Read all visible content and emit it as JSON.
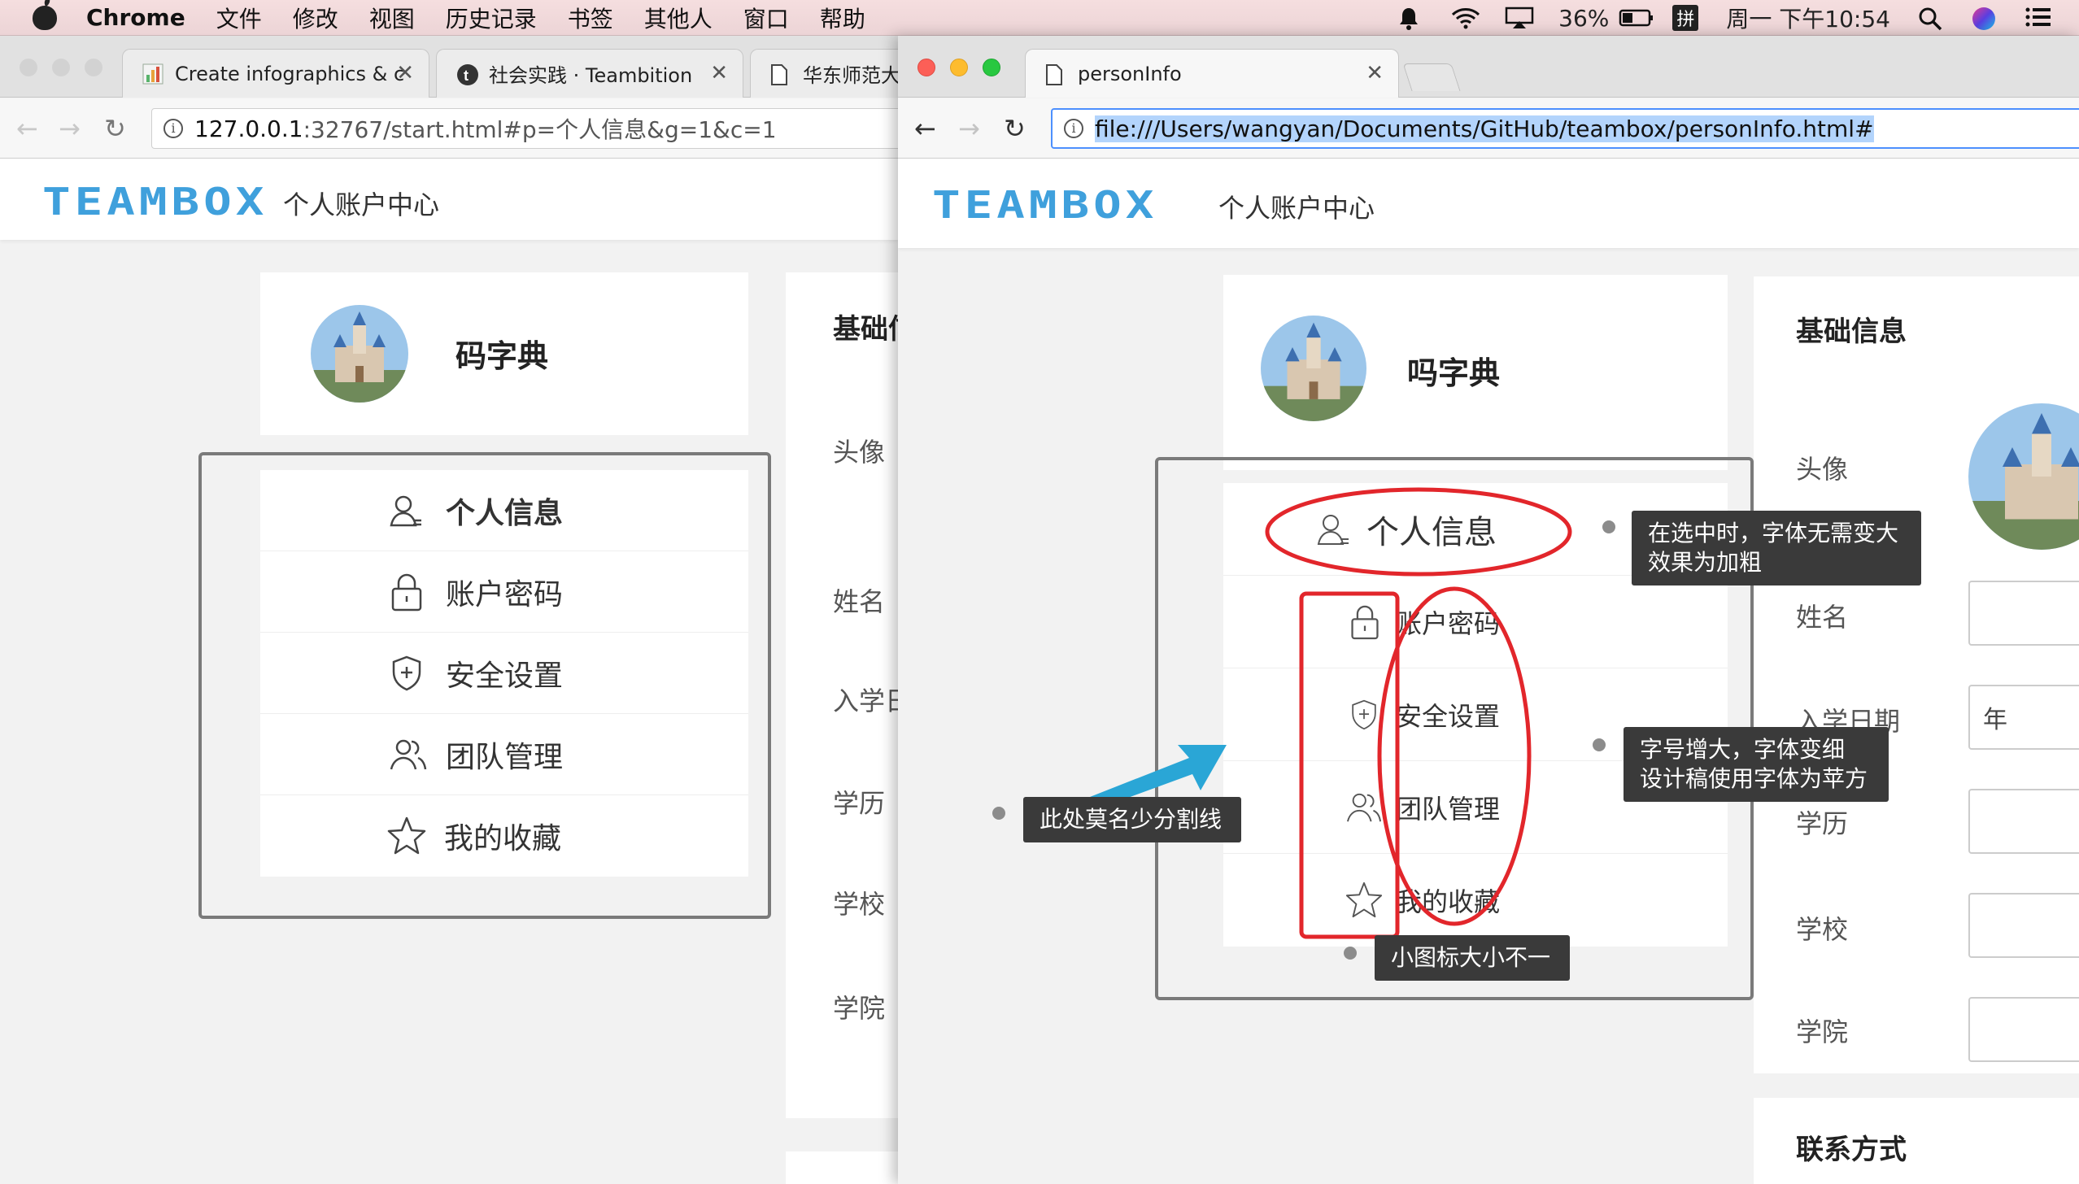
{
  "menubar": {
    "app": "Chrome",
    "items": [
      "文件",
      "修改",
      "视图",
      "历史记录",
      "书签",
      "其他人",
      "窗口",
      "帮助"
    ],
    "battery": "36%",
    "ime": "拼",
    "clock": "周一 下午10:54"
  },
  "left_window": {
    "tabs": [
      {
        "title": "Create infographics & c",
        "icon": "infogram-icon"
      },
      {
        "title": "社会实践 · Teambition",
        "icon": "teambition-icon"
      },
      {
        "title": "华东师范大学",
        "icon": "document-icon"
      }
    ],
    "url_host": "127.0.0.1",
    "url_rest": ":32767/start.html#p=个人信息&g=1&c=1",
    "logo": "TEAMBOX",
    "header_subtitle": "个人账户中心",
    "profile_name": "码字典",
    "menu": [
      "个人信息",
      "账户密码",
      "安全设置",
      "团队管理",
      "我的收藏"
    ],
    "section_title": "基础信",
    "fields": [
      "头像",
      "姓名",
      "入学日",
      "学历",
      "学校",
      "学院"
    ]
  },
  "right_window": {
    "tab_title": "personInfo",
    "url": "file:///Users/wangyan/Documents/GitHub/teambox/personInfo.html#",
    "logo": "TEAMBOX",
    "header_subtitle": "个人账户中心",
    "profile_name": "吗字典",
    "menu": [
      "个人信息",
      "账户密码",
      "安全设置",
      "团队管理",
      "我的收藏"
    ],
    "section_title": "基础信息",
    "fields": [
      "头像",
      "姓名",
      "入学日期",
      "学历",
      "学校",
      "学院"
    ],
    "date_input_value": "年",
    "contact_title": "联系方式"
  },
  "annotations": {
    "selected_note": "在选中时，字体无需变大\n效果为加粗",
    "font_note": "字号增大，字体变细\n设计稿使用字体为苹方",
    "divider_note": "此处莫名少分割线",
    "icon_note": "小图标大小不一"
  },
  "colors": {
    "logo_blue": "#3fa0dc",
    "annotation_red": "#e2262b",
    "arrow_blue": "#2aa6d6",
    "tooltip_bg": "#3a3a3a"
  }
}
